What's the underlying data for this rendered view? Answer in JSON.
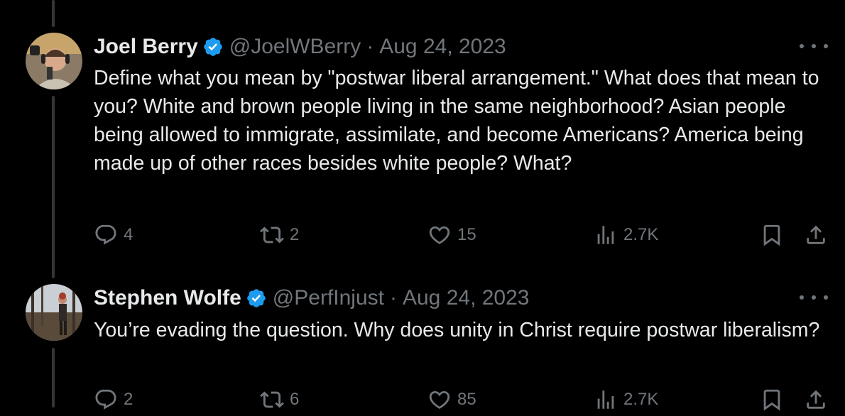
{
  "tweets": [
    {
      "name": "Joel Berry",
      "handle": "@JoelWBerry",
      "date": "Aug 24, 2023",
      "text": "Define what you mean by \"postwar liberal arrangement.\" What does that mean to you? White and brown people living in the same neighborhood? Asian people being allowed to immigrate, assimilate, and become Americans? America being made up of other races besides white people? What?",
      "replies": "4",
      "reposts": "2",
      "likes": "15",
      "views": "2.7K",
      "avatar_bg": "#6b5a4a"
    },
    {
      "name": "Stephen Wolfe",
      "handle": "@PerfInjust",
      "date": "Aug 24, 2023",
      "text": "You’re evading the question. Why does unity in Christ require postwar liberalism?",
      "replies": "2",
      "reposts": "6",
      "likes": "85",
      "views": "2.7K",
      "avatar_bg": "#4a4f45"
    }
  ],
  "dot_separator": "·",
  "colors": {
    "verified": "#1d9bf0",
    "muted": "#71767b",
    "text": "#e7e9ea",
    "line": "#333639"
  },
  "icons": [
    "reply-icon",
    "repost-icon",
    "like-icon",
    "views-icon",
    "bookmark-icon",
    "share-icon",
    "more-icon",
    "verified-badge-icon"
  ]
}
